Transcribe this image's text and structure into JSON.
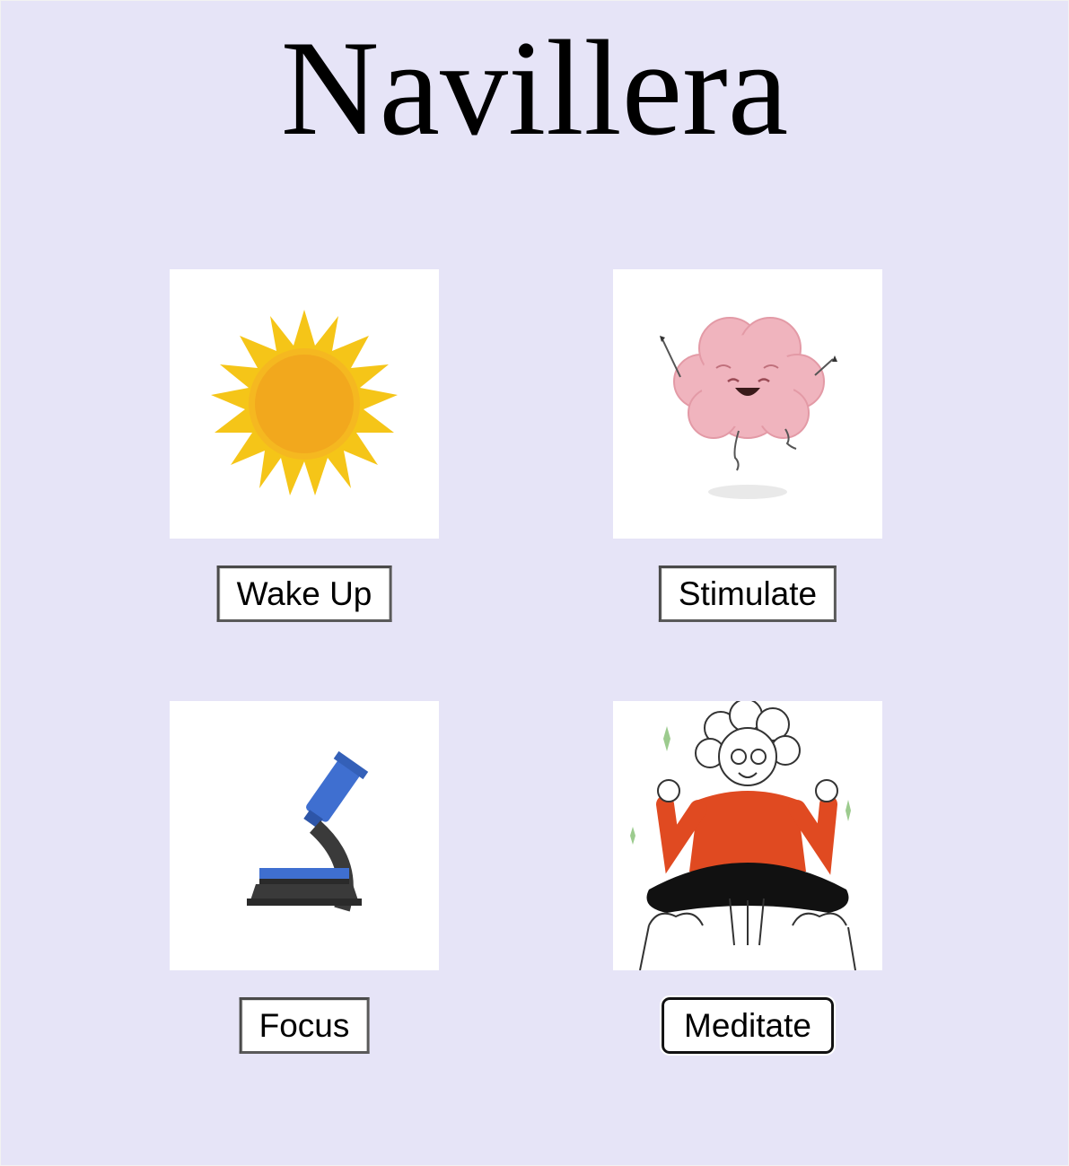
{
  "app": {
    "title": "Navillera"
  },
  "activities": [
    {
      "label": "Wake Up",
      "icon": "sun-icon"
    },
    {
      "label": "Stimulate",
      "icon": "happy-brain-icon"
    },
    {
      "label": "Focus",
      "icon": "microscope-icon"
    },
    {
      "label": "Meditate",
      "icon": "meditating-person-icon"
    }
  ],
  "colors": {
    "background": "#e6e4f7",
    "sun": "#f2a81d",
    "sun_rays": "#f5c518",
    "brain": "#f0b4be",
    "microscope": "#3f6fd0",
    "sweater": "#e04a21"
  }
}
